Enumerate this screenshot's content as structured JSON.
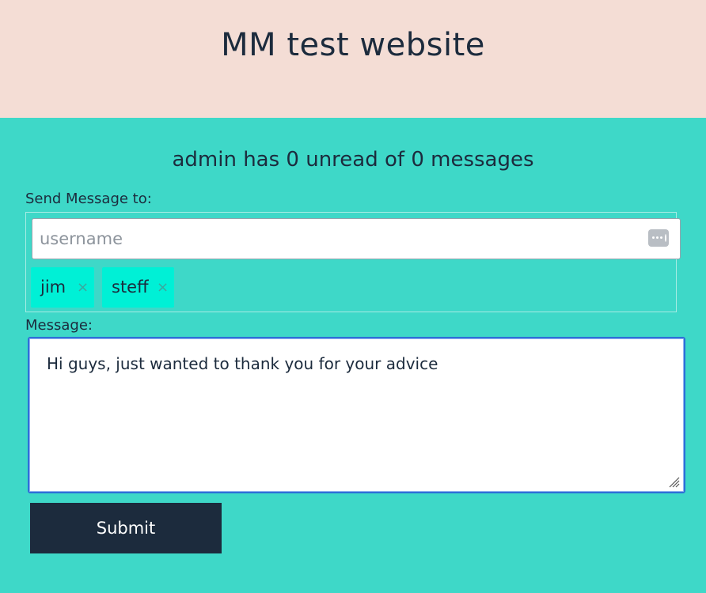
{
  "header": {
    "title": "MM test website"
  },
  "inbox": {
    "status_text": "admin has 0 unread of 0 messages"
  },
  "form": {
    "send_to_label": "Send Message to:",
    "username_placeholder": "username",
    "username_value": "",
    "recipients": [
      {
        "name": "jim",
        "remove": "×"
      },
      {
        "name": "steff",
        "remove": "×"
      }
    ],
    "message_label": "Message:",
    "message_value": "Hi guys, just wanted to thank you for your advice",
    "submit_label": "Submit"
  },
  "icons": {
    "autofill": "password-manager-icon",
    "chip_remove": "close-icon",
    "resize": "resize-grip-icon"
  },
  "colors": {
    "header_bg": "#f4ddd5",
    "main_bg": "#3ed8c8",
    "chip_bg": "#00f0d6",
    "text_dark": "#1c2b3d",
    "focus_border": "#2f6fd8"
  }
}
